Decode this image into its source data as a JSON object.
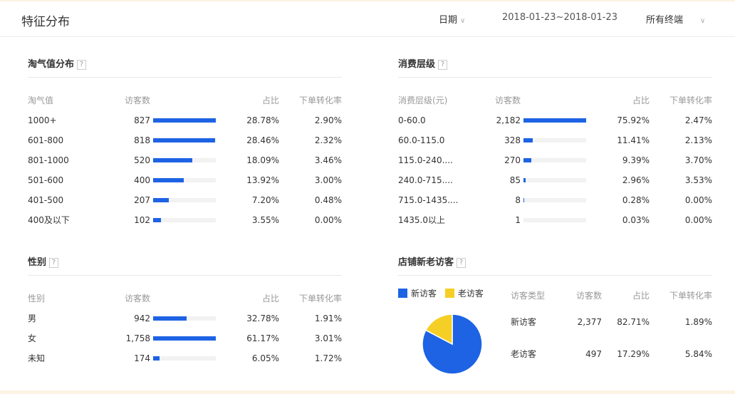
{
  "header": {
    "title": "特征分布",
    "date_label": "日期",
    "date_range": "2018-01-23~2018-01-23",
    "terminal": "所有终端"
  },
  "colors": {
    "bar": "#1d63e4",
    "new": "#1d63e4",
    "old": "#f5cf25"
  },
  "taoqi": {
    "title": "淘气值分布",
    "headers": [
      "淘气值",
      "访客数",
      "占比",
      "下单转化率"
    ],
    "rows": [
      [
        "1000+",
        "827",
        "28.78%",
        "2.90%"
      ],
      [
        "601-800",
        "818",
        "28.46%",
        "2.32%"
      ],
      [
        "801-1000",
        "520",
        "18.09%",
        "3.46%"
      ],
      [
        "501-600",
        "400",
        "13.92%",
        "3.00%"
      ],
      [
        "401-500",
        "207",
        "7.20%",
        "0.48%"
      ],
      [
        "400及以下",
        "102",
        "3.55%",
        "0.00%"
      ]
    ]
  },
  "spend": {
    "title": "消费层级",
    "headers": [
      "消费层级(元)",
      "访客数",
      "占比",
      "下单转化率"
    ],
    "rows": [
      [
        "0-60.0",
        "2,182",
        "75.92%",
        "2.47%"
      ],
      [
        "60.0-115.0",
        "328",
        "11.41%",
        "2.13%"
      ],
      [
        "115.0-240....",
        "270",
        "9.39%",
        "3.70%"
      ],
      [
        "240.0-715....",
        "85",
        "2.96%",
        "3.53%"
      ],
      [
        "715.0-1435....",
        "8",
        "0.28%",
        "0.00%"
      ],
      [
        "1435.0以上",
        "1",
        "0.03%",
        "0.00%"
      ]
    ]
  },
  "gender": {
    "title": "性别",
    "headers": [
      "性别",
      "访客数",
      "占比",
      "下单转化率"
    ],
    "rows": [
      [
        "男",
        "942",
        "32.78%",
        "1.91%"
      ],
      [
        "女",
        "1,758",
        "61.17%",
        "3.01%"
      ],
      [
        "未知",
        "174",
        "6.05%",
        "1.72%"
      ]
    ]
  },
  "visitors": {
    "title": "店铺新老访客",
    "legend": [
      "新访客",
      "老访客"
    ],
    "headers": [
      "访客类型",
      "访客数",
      "占比",
      "下单转化率"
    ],
    "rows": [
      [
        "新访客",
        "2,377",
        "82.71%",
        "1.89%"
      ],
      [
        "老访客",
        "497",
        "17.29%",
        "5.84%"
      ]
    ],
    "chart_data": {
      "type": "pie",
      "labels": [
        "新访客",
        "老访客"
      ],
      "values": [
        82.71,
        17.29
      ]
    }
  }
}
